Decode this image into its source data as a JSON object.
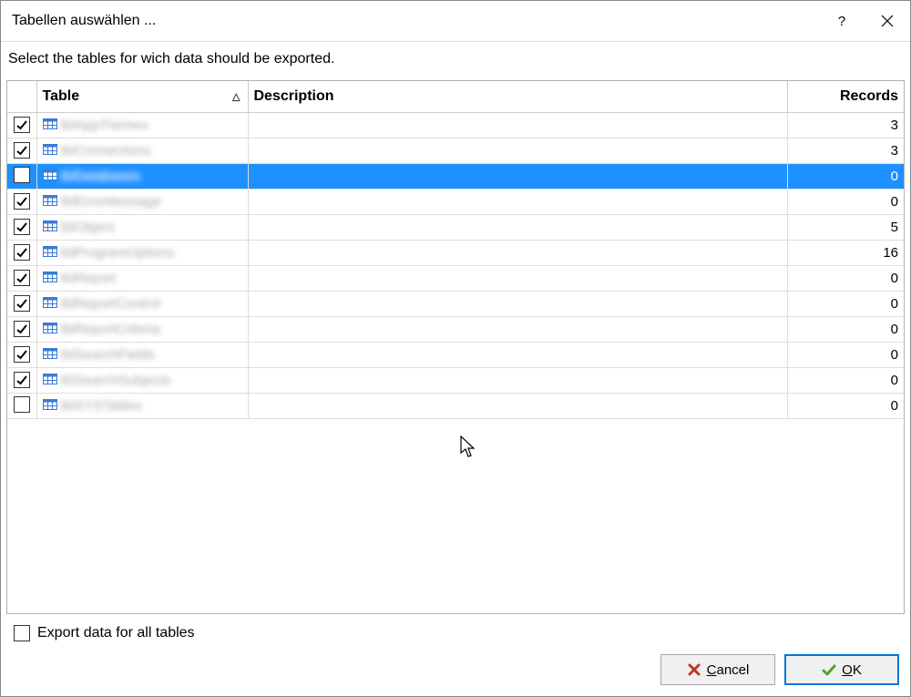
{
  "window": {
    "title": "Tabellen auswählen ..."
  },
  "instruction": "Select the tables for wich data should be exported.",
  "columns": {
    "table": "Table",
    "description": "Description",
    "records": "Records",
    "sortIndicator": "△"
  },
  "rows": [
    {
      "checked": true,
      "selected": false,
      "name": "tblAppThemes",
      "description": "",
      "records": 3
    },
    {
      "checked": true,
      "selected": false,
      "name": "tblConnections",
      "description": "",
      "records": 3
    },
    {
      "checked": false,
      "selected": true,
      "name": "tblDatabases",
      "description": "",
      "records": 0
    },
    {
      "checked": true,
      "selected": false,
      "name": "tblErrorMessage",
      "description": "",
      "records": 0
    },
    {
      "checked": true,
      "selected": false,
      "name": "tblObject",
      "description": "",
      "records": 5
    },
    {
      "checked": true,
      "selected": false,
      "name": "tblProgramOptions",
      "description": "",
      "records": 16
    },
    {
      "checked": true,
      "selected": false,
      "name": "tblReport",
      "description": "",
      "records": 0
    },
    {
      "checked": true,
      "selected": false,
      "name": "tblReportControl",
      "description": "",
      "records": 0
    },
    {
      "checked": true,
      "selected": false,
      "name": "tblReportCriteria",
      "description": "",
      "records": 0
    },
    {
      "checked": true,
      "selected": false,
      "name": "tblSearchFields",
      "description": "",
      "records": 0
    },
    {
      "checked": true,
      "selected": false,
      "name": "tblSearchSubjects",
      "description": "",
      "records": 0
    },
    {
      "checked": false,
      "selected": false,
      "name": "tblSYSTables",
      "description": "",
      "records": 0
    }
  ],
  "exportAll": {
    "checked": false,
    "label": "Export data for all tables"
  },
  "buttons": {
    "cancel": "Cancel",
    "ok": "OK"
  }
}
